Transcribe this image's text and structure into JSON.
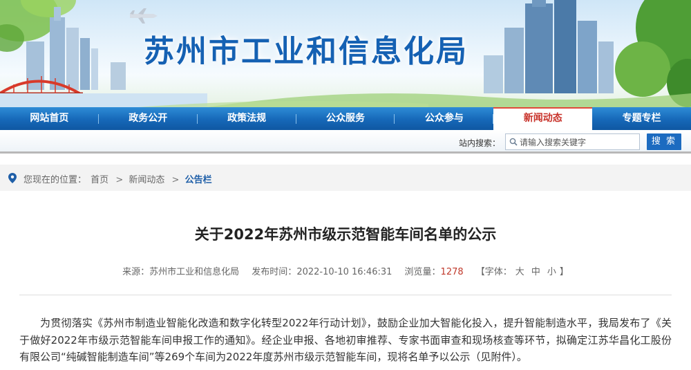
{
  "site": {
    "title": "苏州市工业和信息化局"
  },
  "nav": {
    "items": [
      {
        "label": "网站首页"
      },
      {
        "label": "政务公开"
      },
      {
        "label": "政策法规"
      },
      {
        "label": "公众服务"
      },
      {
        "label": "公众参与"
      },
      {
        "label": "新闻动态"
      },
      {
        "label": "专题专栏"
      }
    ],
    "active_index": 5
  },
  "search": {
    "label": "站内搜索：",
    "placeholder": "请输入搜索关键字",
    "button": "搜 索"
  },
  "breadcrumb": {
    "prefix": "您现在的位置：",
    "items": [
      "首页",
      "新闻动态",
      "公告栏"
    ],
    "separator": ">"
  },
  "article": {
    "title": "关于2022年苏州市级示范智能车间名单的公示",
    "meta": {
      "source_label": "来源：",
      "source": "苏州市工业和信息化局",
      "time_label": "发布时间：",
      "time": "2022-10-10 16:46:31",
      "views_label": "浏览量：",
      "views": "1278",
      "font_open": "【字体：",
      "font_large": "大",
      "font_medium": "中",
      "font_small": "小",
      "font_close": "】"
    },
    "body": "为贯彻落实《苏州市制造业智能化改造和数字化转型2022年行动计划》，鼓励企业加大智能化投入，提升智能制造水平，我局发布了《关于做好2022年市级示范智能车间申报工作的通知》。经企业申报、各地初审推荐、专家书面审查和现场核查等环节，拟确定江苏华昌化工股份有限公司“纯碱智能制造车间”等269个车间为2022年度苏州市级示范智能车间，现将名单予以公示（见附件）。"
  },
  "colors": {
    "brand_blue": "#1561b3",
    "nav_blue": "#1668b8",
    "active_red": "#c8322a",
    "views_red": "#c0392b"
  },
  "icons": {
    "search": "search-icon",
    "location": "location-pin-icon"
  }
}
